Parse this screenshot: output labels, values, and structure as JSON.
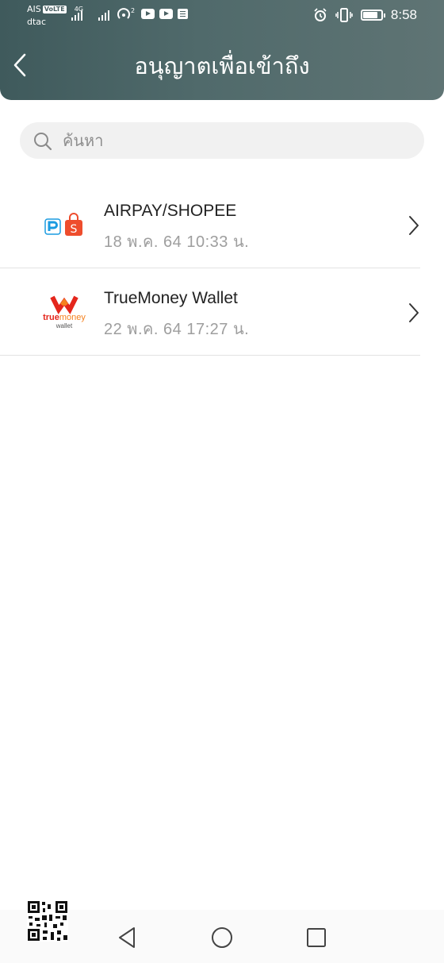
{
  "status_bar": {
    "carrier_1": "AIS",
    "volte": "VoLTE",
    "network_type": "4G",
    "carrier_2": "dtac",
    "time": "8:58",
    "icons": [
      "signal-icon",
      "hotspot-icon",
      "youtube-icon",
      "youtube-icon",
      "notification-icon",
      "alarm-icon",
      "vibrate-icon",
      "battery-icon"
    ]
  },
  "header": {
    "title": "อนุญาตเพื่อเข้าถึง",
    "back_icon": "chevron-left-icon"
  },
  "search": {
    "placeholder": "ค้นหา",
    "value": ""
  },
  "apps": [
    {
      "name": "AIRPAY/SHOPEE",
      "date": "18 พ.ค. 64  10:33 น."
    },
    {
      "name": "TrueMoney Wallet",
      "date": "22 พ.ค. 64  17:27 น.",
      "logo_text_1": "true",
      "logo_text_2": "money",
      "logo_text_3": "wallet"
    }
  ],
  "nav": {
    "buttons": [
      "back-triangle-icon",
      "home-circle-icon",
      "recents-square-icon"
    ]
  },
  "colors": {
    "header": "#4f6869",
    "shopee": "#ee4d2d",
    "airpay": "#1a9be0",
    "truemoney_red": "#e4261c",
    "truemoney_orange": "#f58220"
  }
}
